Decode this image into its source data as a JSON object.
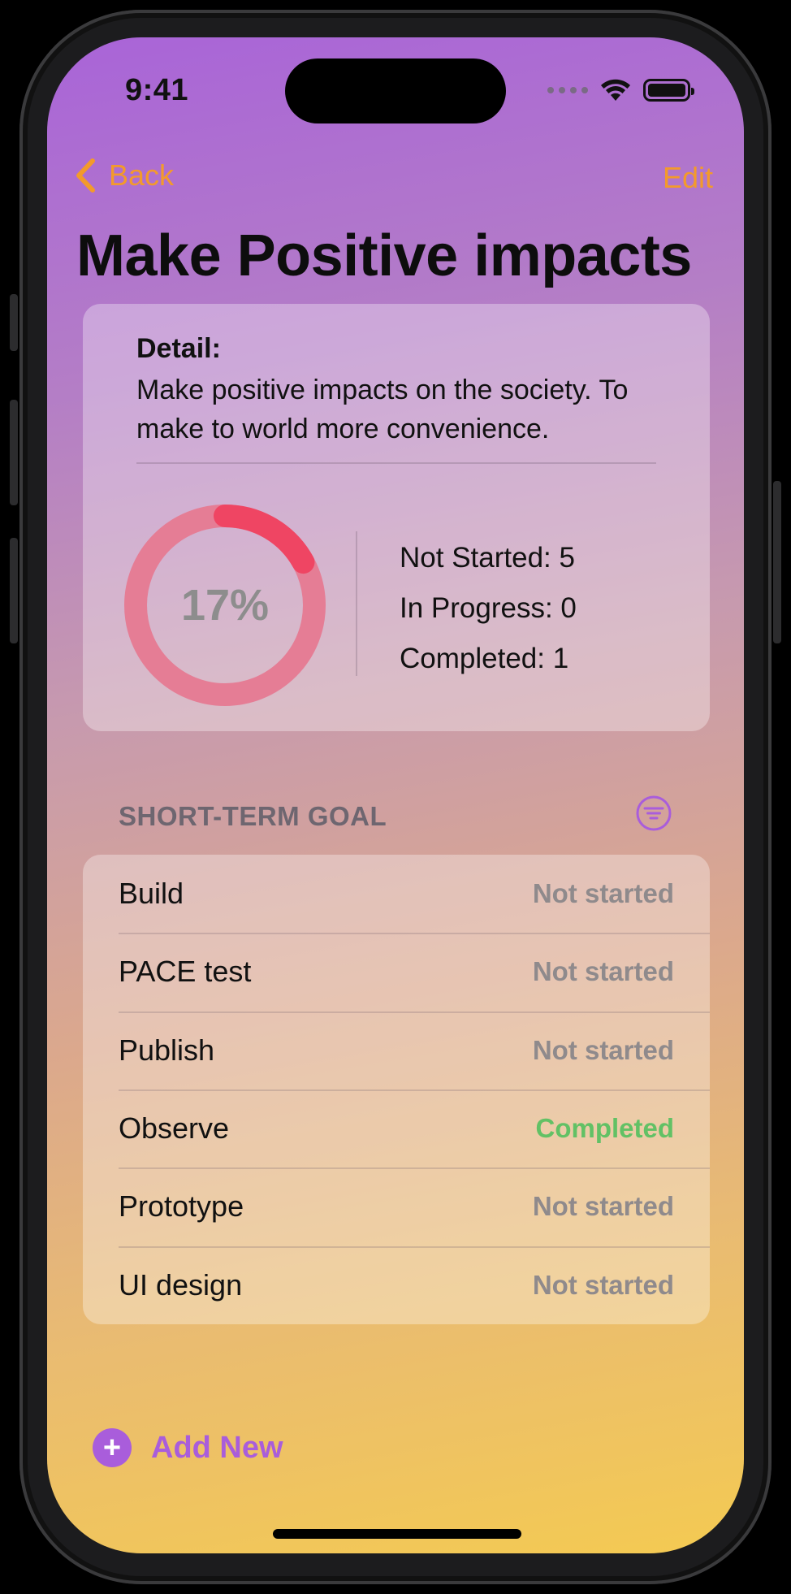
{
  "status_bar": {
    "time": "9:41"
  },
  "nav": {
    "back_label": "Back",
    "edit_label": "Edit"
  },
  "title": "Make Positive impacts",
  "detail": {
    "heading": "Detail:",
    "text": "Make positive impacts on the society. To make to world more convenience."
  },
  "progress": {
    "percent_label": "17%",
    "fraction": 0.17,
    "ring_track_color": "#e57d95",
    "ring_fill_color": "#ef4563",
    "not_started": "Not Started: 5",
    "in_progress": "In Progress: 0",
    "completed": "Completed: 1"
  },
  "section": {
    "title": "SHORT-TERM GOAL",
    "filter_icon": "filter-icon"
  },
  "goals": [
    {
      "name": "Build",
      "status": "Not started"
    },
    {
      "name": "PACE test",
      "status": "Not started"
    },
    {
      "name": "Publish",
      "status": "Not started"
    },
    {
      "name": "Observe",
      "status": "Completed"
    },
    {
      "name": "Prototype",
      "status": "Not started"
    },
    {
      "name": "UI design",
      "status": "Not started"
    }
  ],
  "add_new": {
    "label": "Add New",
    "icon": "plus-icon"
  },
  "colors": {
    "accent_orange": "#f39a2b",
    "accent_purple": "#a95ddb",
    "status_completed": "#62c165",
    "status_not_started": "#8f8a8c"
  }
}
